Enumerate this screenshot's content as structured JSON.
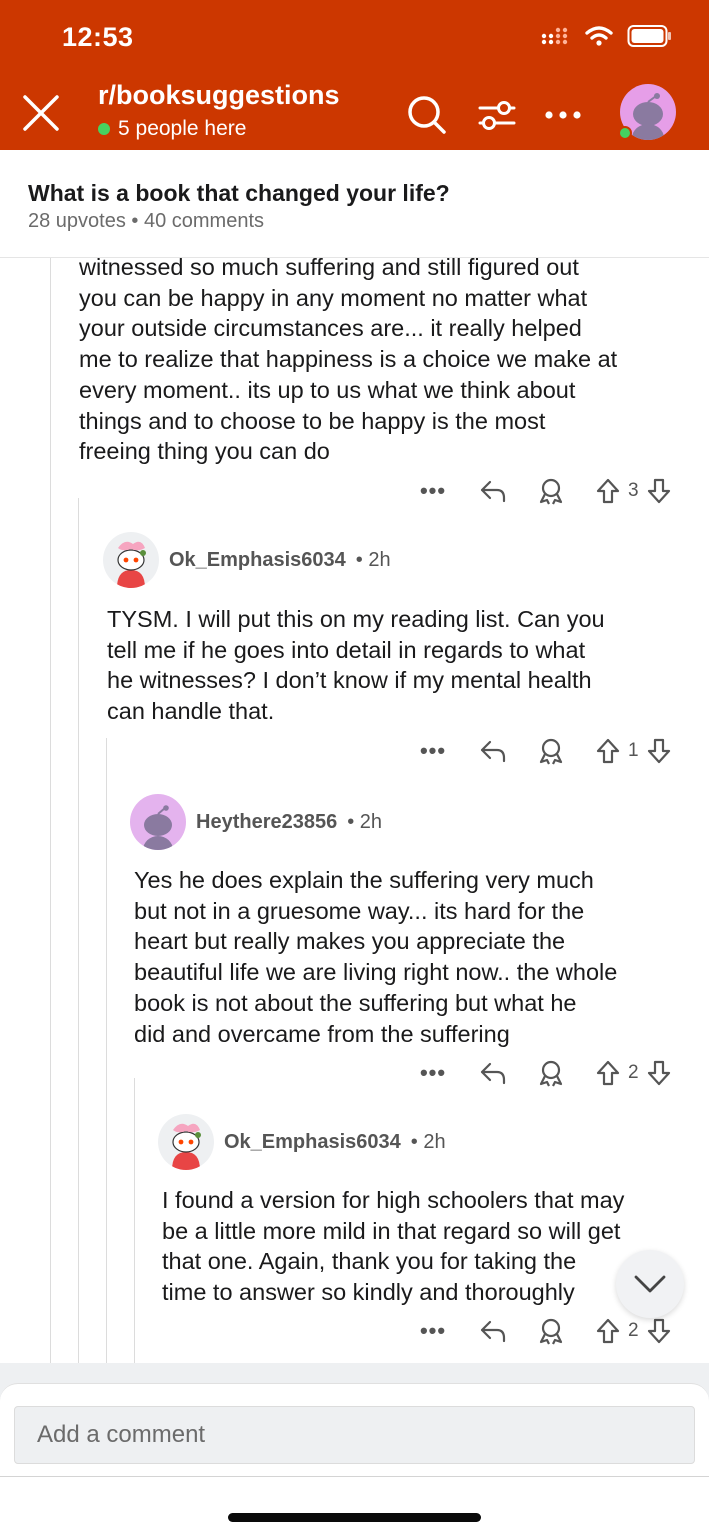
{
  "status_bar": {
    "time": "12:53"
  },
  "header": {
    "subreddit": "r/booksuggestions",
    "presence": "5 people here",
    "icons": [
      "close-icon",
      "search-icon",
      "filter-icon",
      "more-icon",
      "avatar"
    ],
    "colors": {
      "background": "#cc3700",
      "online": "#46d160"
    }
  },
  "post": {
    "title": "What is a book that changed your life?",
    "meta": "28 upvotes • 40 comments"
  },
  "comments": [
    {
      "author": "",
      "time": "",
      "lines": [
        "witnessed so much suffering and still figured out",
        "you can be happy in any moment no matter what",
        "your outside circumstances are... it really helped",
        "me to realize that happiness is a choice we make at",
        "every moment.. its up to us what we think about",
        "things and to choose to be happy is the most",
        "freeing thing you can do"
      ],
      "votes": "3"
    },
    {
      "author": "Ok_Emphasis6034",
      "time": "• 2h",
      "lines": [
        "TYSM. I will put this on my reading list. Can you",
        "tell me if he goes into detail in regards to what",
        "he witnesses?  I don’t know if my mental health",
        "can handle that."
      ],
      "votes": "1"
    },
    {
      "author": "Heythere23856",
      "time": "• 2h",
      "lines": [
        "Yes he does explain the suffering very much",
        "but not in a gruesome way... its hard for the",
        "heart but really makes you appreciate the",
        "beautiful life we are living right now.. the whole",
        "book is not about the suffering but what he",
        "did and overcame from the suffering"
      ],
      "votes": "2"
    },
    {
      "author": "Ok_Emphasis6034",
      "time": "• 2h",
      "lines": [
        "I found a version for high schoolers that may",
        "be a little more mild in that regard so will get",
        "that one. Again, thank you for taking the",
        "time to answer so kindly and thoroughly"
      ],
      "votes": "2"
    }
  ],
  "actions": {
    "more": "•••"
  },
  "composer": {
    "placeholder": "Add a comment"
  }
}
